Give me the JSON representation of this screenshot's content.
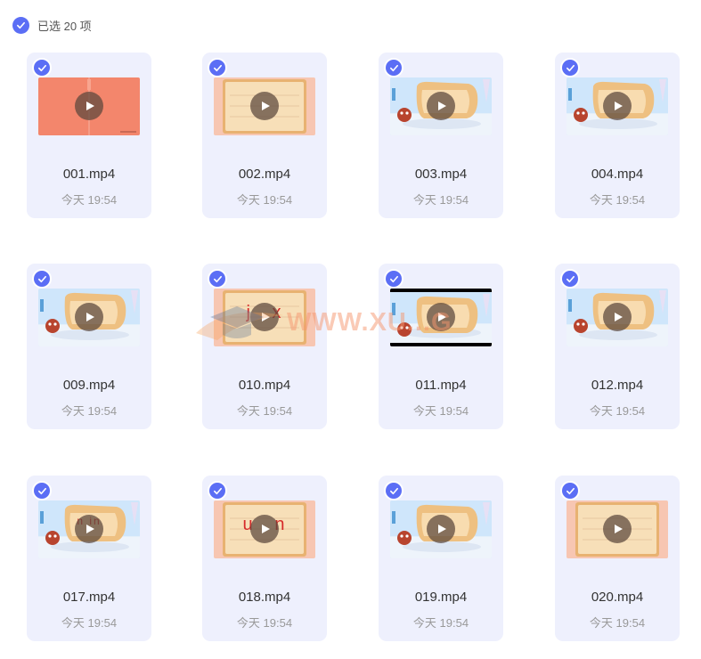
{
  "header": {
    "selected_text": "已选 20 项"
  },
  "watermark": "WWW.XU...G",
  "colors": {
    "accent": "#5b6ef5",
    "card_bg": "#eef0fd"
  },
  "files": [
    {
      "name": "001.mp4",
      "time": "今天 19:54",
      "thumb": "salmon"
    },
    {
      "name": "002.mp4",
      "time": "今天 19:54",
      "thumb": "paper"
    },
    {
      "name": "003.mp4",
      "time": "今天 19:54",
      "thumb": "scene"
    },
    {
      "name": "004.mp4",
      "time": "今天 19:54",
      "thumb": "scene"
    },
    {
      "name": "009.mp4",
      "time": "今天 19:54",
      "thumb": "scene"
    },
    {
      "name": "010.mp4",
      "time": "今天 19:54",
      "thumb": "paper",
      "thumb_text": "j   x"
    },
    {
      "name": "011.mp4",
      "time": "今天 19:54",
      "thumb": "scene-letterbox"
    },
    {
      "name": "012.mp4",
      "time": "今天 19:54",
      "thumb": "scene"
    },
    {
      "name": "017.mp4",
      "time": "今天 19:54",
      "thumb": "scene",
      "thumb_text": "n in"
    },
    {
      "name": "018.mp4",
      "time": "今天 19:54",
      "thumb": "paper",
      "thumb_text": "u   n"
    },
    {
      "name": "019.mp4",
      "time": "今天 19:54",
      "thumb": "scene"
    },
    {
      "name": "020.mp4",
      "time": "今天 19:54",
      "thumb": "paper"
    }
  ]
}
